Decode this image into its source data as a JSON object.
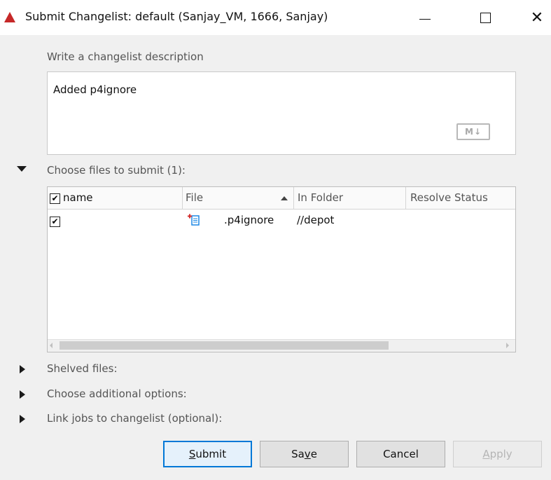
{
  "window": {
    "title": "Submit Changelist: default (Sanjay_VM,  1666,  Sanjay)",
    "controls": {
      "minimize": "minimize",
      "maximize": "maximize",
      "close": "✕"
    }
  },
  "description": {
    "label": "Write a changelist description",
    "value": "Added p4ignore",
    "markdown_badge": "M↓"
  },
  "files": {
    "label": "Choose files to submit (1):",
    "columns": [
      "name",
      "File",
      "In Folder",
      "Resolve Status"
    ],
    "sort_column": "File",
    "rows": [
      {
        "checked": "✔",
        "name": "",
        "file": ".p4ignore",
        "folder": "//depot",
        "resolve_status": ""
      }
    ],
    "header_checked": "✔"
  },
  "sections": {
    "shelved": "Shelved files:",
    "options": "Choose additional options:",
    "jobs": "Link jobs to changelist (optional):"
  },
  "buttons": {
    "submit": {
      "mnemonic": "S",
      "rest": "ubmit"
    },
    "save": {
      "pre": "Sa",
      "mnemonic": "v",
      "post": "e"
    },
    "cancel": "Cancel",
    "apply": {
      "mnemonic": "A",
      "rest": "pply",
      "enabled": false
    }
  },
  "colors": {
    "accent": "#0078d7",
    "app_icon": "#c62828",
    "add_marker": "#d32f2f",
    "file_icon": "#1e88e5"
  }
}
